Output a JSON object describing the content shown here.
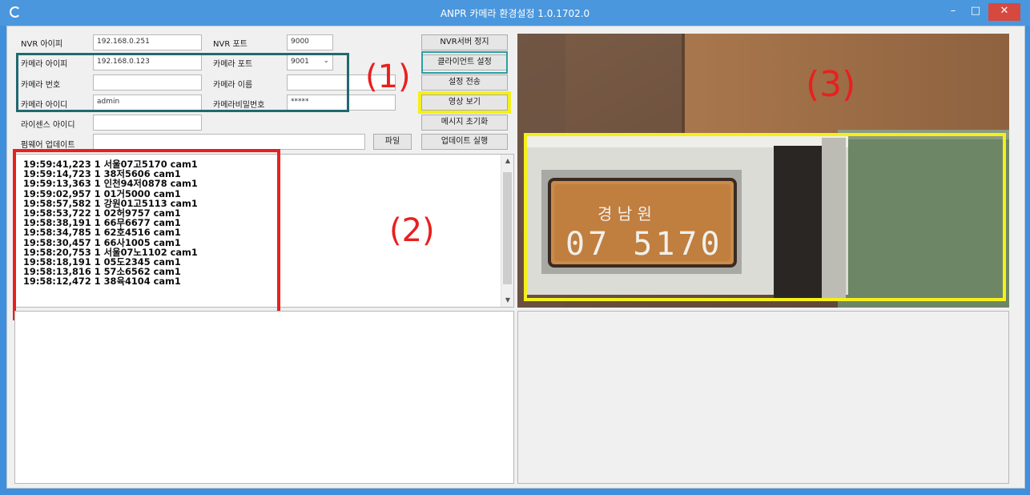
{
  "window": {
    "title": "ANPR 카메라 환경설정 1.0.1702.0",
    "min_icon": "–",
    "max_icon": "□",
    "close_icon": "✕"
  },
  "settings": {
    "nvr_ip_label": "NVR 아이피",
    "nvr_ip_value": "192.168.0.251",
    "nvr_port_label": "NVR 포트",
    "nvr_port_value": "9000",
    "camera_ip_label": "카메라 아이피",
    "camera_ip_value": "192.168.0.123",
    "camera_port_label": "카메라 포트",
    "camera_port_value": "9001",
    "camera_no_label": "카메라 번호",
    "camera_no_value": "",
    "camera_name_label": "카메라 이름",
    "camera_name_value": "",
    "camera_id_label": "카메라 아이디",
    "camera_id_value": "admin",
    "camera_pw_label": "카메라비밀번호",
    "camera_pw_value": "*****",
    "license_id_label": "라이센스 아이디",
    "license_id_value": "",
    "firmware_label": "펌웨어 업데이트",
    "firmware_value": ""
  },
  "buttons": {
    "nvr_stop": "NVR서버 정지",
    "client_settings": "클라이언트 설정",
    "settings_apply": "설정 전송",
    "video_view": "영상 보기",
    "message_clear": "메시지 초기화",
    "file": "파일",
    "update_run": "업데이트 실행"
  },
  "annotations": {
    "n1": "(1)",
    "n2": "(2)",
    "n3": "(3)"
  },
  "plate": {
    "region": "경 남 원",
    "number": "07 5170"
  },
  "log": [
    "19:59:41,223 1 서울07고5170 cam1",
    "19:59:14,723 1 38저5606 cam1",
    "19:59:13,363 1 인천94저0878 cam1",
    "19:59:02,957 1 01거5000 cam1",
    "19:58:57,582 1 강원01고5113 cam1",
    "19:58:53,722 1 02허9757 cam1",
    "19:58:38,191 1 66무6677 cam1",
    "19:58:34,785 1 62호4516 cam1",
    "19:58:30,457 1 66사1005 cam1",
    "19:58:20,753 1 서울07노1102 cam1",
    "19:58:18,191 1 05도2345 cam1",
    "19:58:13,816 1 57소6562 cam1",
    "19:58:12,472 1 38육4104 cam1"
  ],
  "colors": {
    "annotation_red": "#e8201f",
    "annotation_yellow": "#f5f01a",
    "annotation_teal": "#1f6a70",
    "annotation_cyan": "#2a9fa6"
  }
}
